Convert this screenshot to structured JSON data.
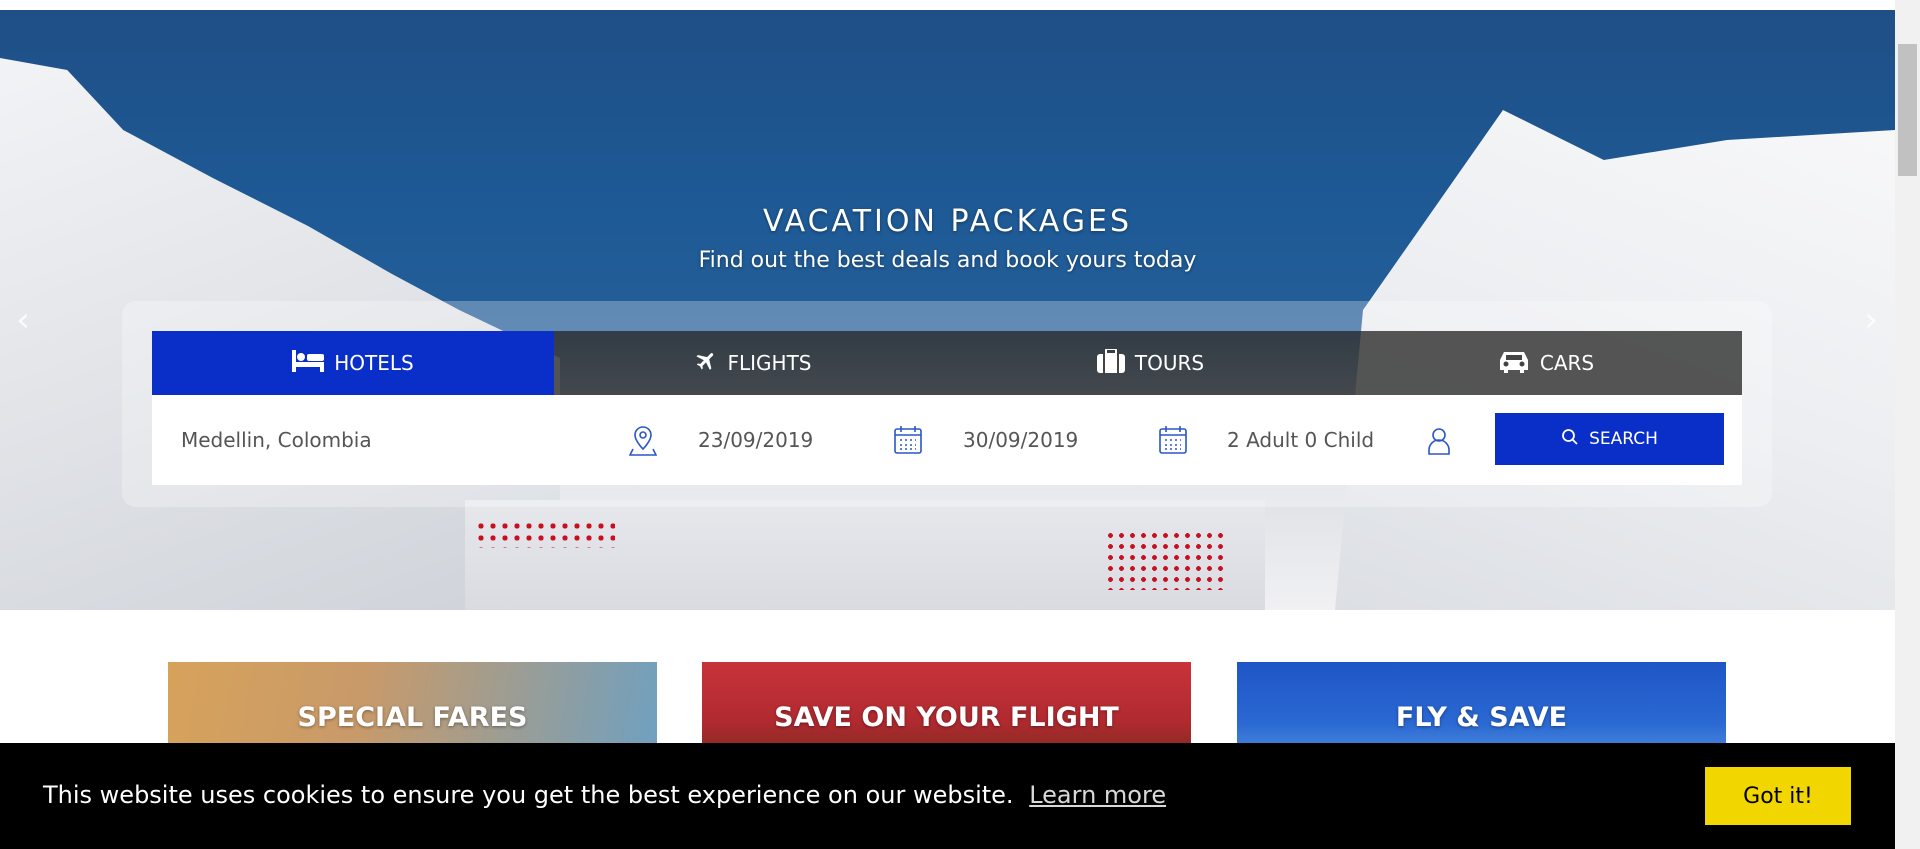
{
  "hero": {
    "title": "VACATION PACKAGES",
    "subtitle": "Find out the best deals and book yours today",
    "prev_arrow": "‹",
    "next_arrow": "›"
  },
  "tabs": [
    {
      "label": "HOTELS",
      "icon": "bed-icon",
      "active": true
    },
    {
      "label": "FLIGHTS",
      "icon": "plane-icon",
      "active": false
    },
    {
      "label": "TOURS",
      "icon": "suitcase-icon",
      "active": false
    },
    {
      "label": "CARS",
      "icon": "car-icon",
      "active": false
    }
  ],
  "search": {
    "destination": "Medellin, Colombia",
    "checkin": "23/09/2019",
    "checkout": "30/09/2019",
    "guests": "2 Adult 0 Child",
    "button_label": "SEARCH"
  },
  "cards": [
    {
      "title": "SPECIAL FARES"
    },
    {
      "title": "SAVE ON YOUR FLIGHT"
    },
    {
      "title": "FLY & SAVE"
    }
  ],
  "cookie": {
    "message": "This website uses cookies to ensure you get the best experience on our website.",
    "link": "Learn more",
    "button": "Got it!"
  },
  "colors": {
    "primary": "#0a2fc8",
    "tabs_bg": "#282828",
    "cookie_bg": "#000000",
    "cookie_button": "#f1d600"
  }
}
